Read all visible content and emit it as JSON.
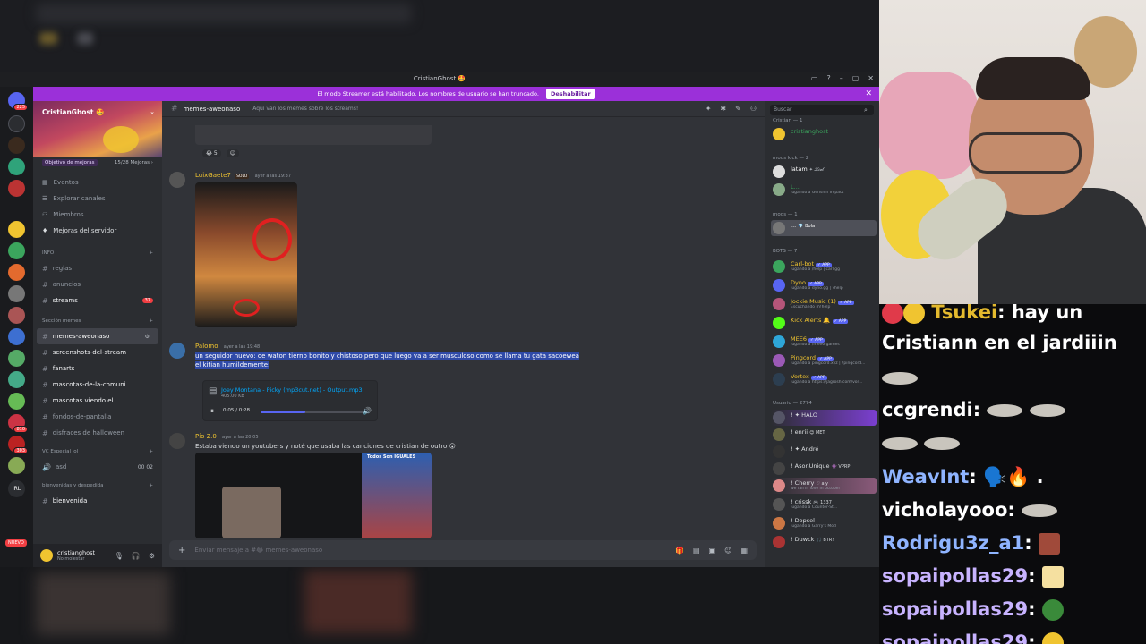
{
  "window": {
    "title": "CristianGhost 🤩",
    "controls": [
      "▭",
      "?",
      "–",
      "▢",
      "✕"
    ]
  },
  "banner": {
    "text": "El modo Streamer está habilitado. Los nombres de usuario se han truncado.",
    "button": "Deshabilitar",
    "close": "✕"
  },
  "rail": {
    "badges": [
      "225",
      "810",
      "303",
      "2"
    ],
    "new_label": "NUEVO",
    "anuncio_label": "ANUNCIO",
    "irl_label": "IRL"
  },
  "server": {
    "name": "CristianGhost 🤩",
    "boost_goal": "Objetivo de mejoras",
    "boost_count": "15/28 Mejoras ›",
    "menu": [
      "Eventos",
      "Explorar canales",
      "Miembros",
      "Mejoras del servidor"
    ],
    "categories": {
      "info": "INFO",
      "memes": "Sección memes",
      "vc": "VC Especial lol",
      "welcome": "bienvenidas y despedida"
    },
    "channels_info": [
      {
        "name": "reglas"
      },
      {
        "name": "anuncios"
      },
      {
        "name": "streams",
        "count": "37"
      }
    ],
    "channels_memes": [
      {
        "name": "memes-aweonaso",
        "active": true
      },
      {
        "name": "screenshots-del-stream"
      },
      {
        "name": "fanarts"
      },
      {
        "name": "mascotas-de-la-comuni..."
      },
      {
        "name": "mascotas viendo el ..."
      },
      {
        "name": "fondos-de-pantalla"
      },
      {
        "name": "disfraces de halloween"
      }
    ],
    "voice": {
      "name": "asd",
      "counts": "00  02"
    },
    "welcome_channel": "bienvenida"
  },
  "user": {
    "name": "cristianghost",
    "status": "No molestar"
  },
  "channel_header": {
    "name": "memes-aweonaso",
    "topic": "Aquí van los memes sobre los streams!",
    "search_placeholder": "Buscar"
  },
  "messages": [
    {
      "reactions": [
        "😂 5",
        "☺"
      ]
    },
    {
      "author": "LuixGaete7",
      "badge": "SOLO",
      "timestamp": "ayer a las 19:37",
      "author_color": "#f0c430"
    },
    {
      "author": "Palomo",
      "timestamp": "ayer a las 19:48",
      "author_color": "#f0c430",
      "text_line1": "un seguidor nuevo: oe waton tierno bonito y chistoso pero que luego va a ser musculoso como se llama tu gata sacoewea",
      "text_line2": "el kitian humildemente:",
      "attachment": {
        "filename": "Joey Montana - Picky (mp3cut.net) - Output.mp3",
        "size": "405.00 KB",
        "time": "0:05 / 0:28",
        "progress": 0.42
      }
    },
    {
      "author": "Pío 2.0",
      "timestamp": "ayer a las 20:05",
      "author_color": "#f0c430",
      "text": "Estaba viendo un youtubers y noté que usaba las canciones de cristian de outro 😮",
      "thumb_label": "Todos Son IGUALES"
    }
  ],
  "composer": {
    "placeholder": "Enviar mensaje a #😂 memes-aweonaso"
  },
  "members": {
    "groups": [
      {
        "label": "Cristian — 1"
      },
      {
        "label": "mods kick — 2"
      },
      {
        "label": "mods — 1"
      },
      {
        "label": "BOTS — 7"
      },
      {
        "label": "Usuario — 2774"
      }
    ],
    "list": [
      {
        "name": "cristianghost",
        "status": "",
        "color": "#3ba55d"
      },
      {
        "name": "latam",
        "status": "",
        "color": "#ffffff",
        "extra": "✦ 𝓚𝓲𝓮𝓵"
      },
      {
        "name": "L...",
        "status": "Jugando a Genshin Impact",
        "color": "#3ba55d"
      },
      {
        "name": "...",
        "status": "",
        "color": "#ffffff",
        "extra": "💎 Bola"
      },
      {
        "name": "Carl-bot",
        "status": "Jugando a /help | carl.gg",
        "color": "#f0c430",
        "tag": "✓ APP"
      },
      {
        "name": "Dyno",
        "status": "Jugando a dyno.gg | ?help",
        "color": "#f0c430",
        "tag": "✓ APP"
      },
      {
        "name": "Jockie Music (1)",
        "status": "Escuchando m!help",
        "color": "#f0c430",
        "tag": "✓ APP"
      },
      {
        "name": "Kick Alerts 🔔",
        "status": "",
        "color": "#f0c430",
        "tag": "✓ APP"
      },
      {
        "name": "MEE6",
        "status": "Jugando a /mee6 games",
        "color": "#f0c430",
        "tag": "✓ APP"
      },
      {
        "name": "Pingcord",
        "status": "Jugando a pingcord.xyz | ?pingcord...",
        "color": "#f0c430",
        "tag": "✓ APP"
      },
      {
        "name": "Vortex",
        "status": "Jugando a https://jagrosh.com/vor...",
        "color": "#f0c430",
        "tag": "✓ APP"
      },
      {
        "name": "! ✦ HALO",
        "status": "",
        "color": "#dbdee1"
      },
      {
        "name": "! enrii",
        "status": "",
        "color": "#dbdee1",
        "extra": "😊 MET"
      },
      {
        "name": "! ✦ André",
        "status": "",
        "color": "#dbdee1"
      },
      {
        "name": "! AsonUnique",
        "status": "",
        "color": "#dbdee1",
        "extra": "👾 VPRP"
      },
      {
        "name": "! Cherry",
        "status": "we fall in love in october",
        "color": "#dbdee1",
        "extra": "♡ aly"
      },
      {
        "name": "! crissk",
        "status": "Jugando a Counter-St...",
        "color": "#dbdee1",
        "extra": "🎮 1337"
      },
      {
        "name": "! Dopsel",
        "status": "Jugando a Garry's Mod",
        "color": "#dbdee1"
      },
      {
        "name": "! Duwck",
        "status": "",
        "color": "#dbdee1",
        "extra": "🎵 BTR!"
      }
    ]
  },
  "twitch_chat": [
    {
      "user": "Tsukei",
      "color": "#ffffff",
      "text": "hay un"
    },
    {
      "user": "",
      "color": "#ffffff",
      "text": "Cristiann en el jardiiin"
    },
    {
      "user": "ccgrendi",
      "color": "#ffffff",
      "text": ""
    },
    {
      "user": "WeavInt",
      "color": "#8fb4ff",
      "text": "🗣️🔥 ."
    },
    {
      "user": "vicholayooo",
      "color": "#ffffff",
      "text": ""
    },
    {
      "user": "Rodrigu3z_a1",
      "color": "#8fb4ff",
      "text": ""
    },
    {
      "user": "sopaipollas29",
      "color": "#c8b3ff",
      "text": ""
    },
    {
      "user": "sopaipollas29",
      "color": "#c8b3ff",
      "text": ""
    },
    {
      "user": "sopaipollas29",
      "color": "#c8b3ff",
      "text": ""
    }
  ]
}
